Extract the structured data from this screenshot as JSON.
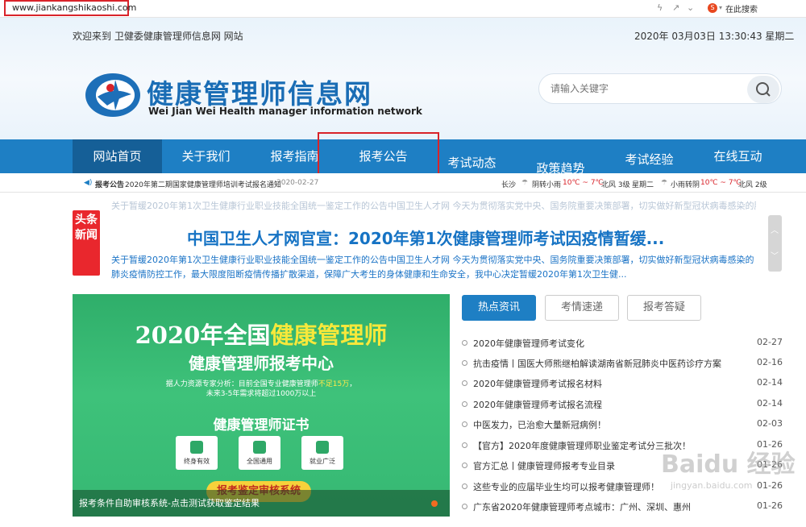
{
  "browser": {
    "url": "www.jiankangshikaoshi.com",
    "search_label": "在此搜索",
    "search_badge": "S"
  },
  "topbar": {
    "welcome": "欢迎来到 卫健委健康管理师信息网 网站",
    "datetime": "2020年 03月03日  13:30:43  星期二"
  },
  "site": {
    "name": "健康管理师信息网",
    "name_en": "Wei Jian Wei Health manager information network"
  },
  "search": {
    "placeholder": "请输入关键字"
  },
  "nav": [
    "网站首页",
    "关于我们",
    "报考指南",
    "报考公告",
    "考试动态",
    "政策趋势",
    "考试经验",
    "在线互动"
  ],
  "ticker": {
    "label": "报考公告",
    "text": "2020年第二期国家健康管理师培训考试报名通知",
    "date": "2020-02-27",
    "weather": [
      {
        "city": "长沙",
        "icon": "rain-icon",
        "desc": "阴转小雨",
        "temp": "10℃ ~ 7℃",
        "wind": "北风 3级",
        "day": "星期二"
      },
      {
        "icon": "rain-icon",
        "desc": "小雨转阴",
        "temp": "10℃ ~ 7℃",
        "wind": "北风 2级"
      }
    ]
  },
  "headline": {
    "badge": "头条新闻",
    "title": "中国卫生人才网官宣：2020年第1次健康管理师考试因疫情暂缓...",
    "summary": "关于暂缓2020年第1次卫生健康行业职业技能全国统一鉴定工作的公告中国卫生人才网 今天为贯彻落实党中央、国务院重要决策部署，切实做好新型冠状病毒感染的肺炎疫情防控工作，最大限度阻断疫情传播扩散渠道，保障广大考生的身体健康和生命安全，我中心决定暂缓2020年第1次卫生健..."
  },
  "banner": {
    "title_prefix": "2020年全国",
    "title_highlight": "健康管理师",
    "subtitle": "健康管理师报考中心",
    "note_a": "据人力资源专家分析：目前全国专业健康管理师",
    "note_b": "不足15万",
    "note_c": "，",
    "note_d": "未来3-5年需求将超过1000万以上",
    "cert_title": "健康管理师证书",
    "features": [
      "终身有效",
      "全国通用",
      "就业广泛"
    ],
    "button": "报考鉴定审核系统",
    "caption": "报考条件自助审核系统-点击测试获取鉴定结果"
  },
  "tabs": [
    "热点资讯",
    "考情速递",
    "报考答疑"
  ],
  "news": [
    {
      "title": "2020年健康管理师考试变化",
      "date": "02-27"
    },
    {
      "title": "抗击疫情丨国医大师熊继柏解读湖南省新冠肺炎中医药诊疗方案",
      "date": "02-16"
    },
    {
      "title": "2020年健康管理师考试报名材料",
      "date": "02-14"
    },
    {
      "title": "2020年健康管理师考试报名流程",
      "date": "02-14"
    },
    {
      "title": "中医发力，已治愈大量新冠病例！",
      "date": "02-03"
    },
    {
      "title": "【官方】2020年度健康管理师职业鉴定考试分三批次！",
      "date": "01-26"
    },
    {
      "title": "官方汇总丨健康管理师报考专业目录",
      "date": "01-26"
    },
    {
      "title": "这些专业的应届毕业生均可以报考健康管理师！",
      "date": "01-26"
    },
    {
      "title": "广东省2020年健康管理师考点城市：广州、深圳、惠州",
      "date": "01-26"
    }
  ],
  "watermark": {
    "main": "Baidu 经验",
    "sub": "jingyan.baidu.com"
  }
}
